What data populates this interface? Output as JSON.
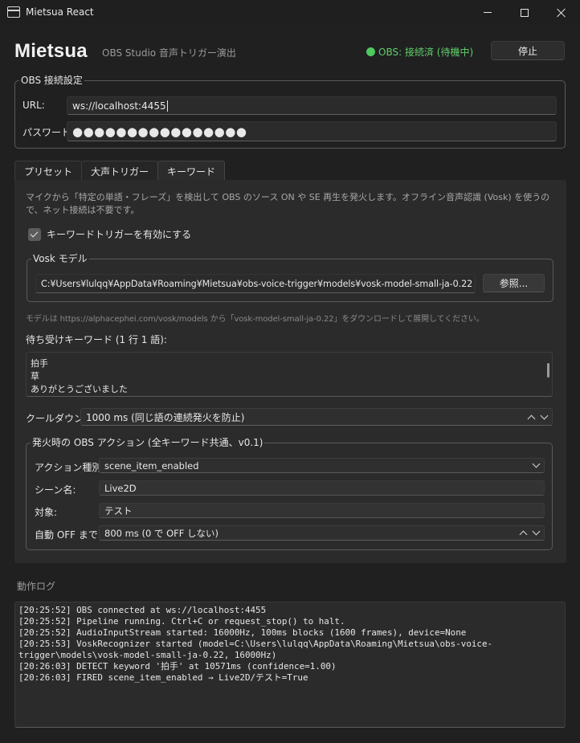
{
  "window": {
    "title": "Mietsua React"
  },
  "header": {
    "brand": "Mietsua",
    "subtitle": "OBS Studio 音声トリガー演出",
    "status": "OBS: 接続済 (待機中)",
    "stop_label": "停止"
  },
  "obs": {
    "group_title": "OBS 接続設定",
    "url_label": "URL:",
    "url_value": "ws://localhost:4455",
    "password_label": "パスワード:",
    "password_mask": "●●●●●●●●●●●●●●●●"
  },
  "tabs": [
    {
      "label": "プリセット",
      "active": false
    },
    {
      "label": "大声トリガー",
      "active": false
    },
    {
      "label": "キーワード",
      "active": true
    }
  ],
  "keyword": {
    "description": "マイクから「特定の単語・フレーズ」を検出して OBS のソース ON や SE 再生を発火します。オフライン音声認識 (Vosk) を使うので、ネット接続は不要です。",
    "enable_label": "キーワードトリガーを有効にする",
    "enable_checked": true,
    "vosk_group_title": "Vosk モデル",
    "model_path": "C:¥Users¥lulqq¥AppData¥Roaming¥Mietsua¥obs-voice-trigger¥models¥vosk-model-small-ja-0.22",
    "browse_label": "参照...",
    "hint": "モデルは https://alphacephei.com/vosk/models から「vosk-model-small-ja-0.22」をダウンロードして展開してください。",
    "list_label": "待ち受けキーワード (1 行 1 語):",
    "keywords": [
      "拍手",
      "草",
      "ありがとうございました"
    ],
    "cooldown_label": "クールダウン:",
    "cooldown_value": "1000 ms (同じ語の連続発火を防止)",
    "action_group_title": "発火時の OBS アクション (全キーワード共通、v0.1)",
    "action_type_label": "アクション種別:",
    "action_type_value": "scene_item_enabled",
    "scene_label": "シーン名:",
    "scene_value": "Live2D",
    "target_label": "対象:",
    "target_value": "テスト",
    "auto_off_label": "自動 OFF まで:",
    "auto_off_value": "800 ms (0 で OFF しない)"
  },
  "log": {
    "title": "動作ログ",
    "lines": [
      "[20:25:52] OBS connected at ws://localhost:4455",
      "[20:25:52] Pipeline running. Ctrl+C or request_stop() to halt.",
      "[20:25:52] AudioInputStream started: 16000Hz, 100ms blocks (1600 frames), device=None",
      "[20:25:53] VoskRecognizer started (model=C:\\Users\\lulqq\\AppData\\Roaming\\Mietsua\\obs-voice-",
      "trigger\\models\\vosk-model-small-ja-0.22, 16000Hz)",
      "[20:26:03] DETECT keyword '拍手' at 10571ms (confidence=1.00)",
      "[20:26:03] FIRED scene_item_enabled → Live2D/テスト=True"
    ]
  },
  "colors": {
    "accent_status": "#5fcf6b",
    "background": "#202020",
    "panel": "#2b2b2b"
  }
}
